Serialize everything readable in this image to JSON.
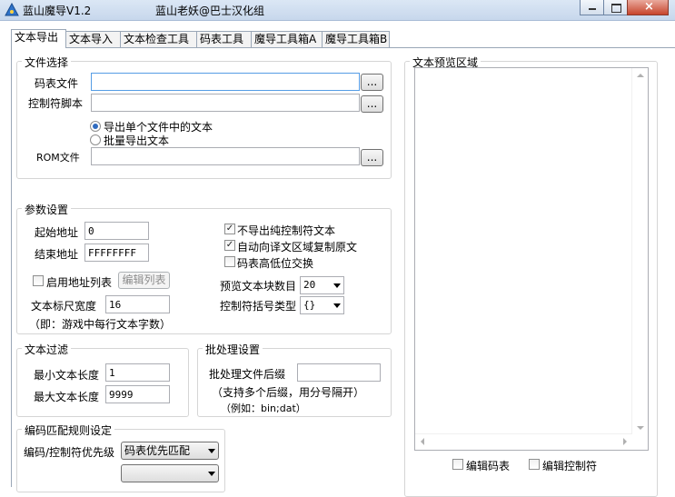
{
  "window": {
    "title": "蓝山魔导V1.2",
    "subtitle": "蓝山老妖@巴士汉化组"
  },
  "tabs": [
    {
      "label": "文本导出",
      "active": true
    },
    {
      "label": "文本导入"
    },
    {
      "label": "文本检查工具"
    },
    {
      "label": "码表工具"
    },
    {
      "label": "魔导工具箱A"
    },
    {
      "label": "魔导工具箱B"
    }
  ],
  "file_select": {
    "legend": "文件选择",
    "code_table_label": "码表文件",
    "code_table_value": "",
    "control_script_label": "控制符脚本",
    "control_script_value": "",
    "browse_label": "...",
    "radio_single": "导出单个文件中的文本",
    "radio_batch": "批量导出文本",
    "rom_label": "ROM文件",
    "rom_value": ""
  },
  "params": {
    "legend": "参数设置",
    "start_addr_label": "起始地址",
    "start_addr_value": "0",
    "end_addr_label": "结束地址",
    "end_addr_value": "FFFFFFFF",
    "enable_addr_list_label": "启用地址列表",
    "edit_list_label": "编辑列表",
    "ruler_width_label": "文本标尺宽度",
    "ruler_width_value": "16",
    "ruler_hint": "（即：游戏中每行文本字数）",
    "no_control_text_label": "不导出纯控制符文本",
    "auto_copy_label": "自动向译文区域复制原文",
    "swap_bytes_label": "码表高低位交换",
    "preview_blocks_label": "预览文本块数目",
    "preview_blocks_value": "20",
    "bracket_type_label": "控制符括号类型",
    "bracket_type_value": "{}"
  },
  "filter": {
    "legend": "文本过滤",
    "min_len_label": "最小文本长度",
    "min_len_value": "1",
    "max_len_label": "最大文本长度",
    "max_len_value": "9999"
  },
  "batch": {
    "legend": "批处理设置",
    "suffix_label": "批处理文件后缀",
    "suffix_value": "",
    "hint1": "（支持多个后缀，用分号隔开）",
    "hint2": "（例如：bin;dat）"
  },
  "encoding": {
    "legend": "编码匹配规则设定",
    "priority_label": "编码/控制符优先级",
    "priority_value": "码表优先匹配"
  },
  "preview": {
    "legend": "文本预览区域",
    "edit_code_table_label": "编辑码表",
    "edit_control_label": "编辑控制符"
  }
}
